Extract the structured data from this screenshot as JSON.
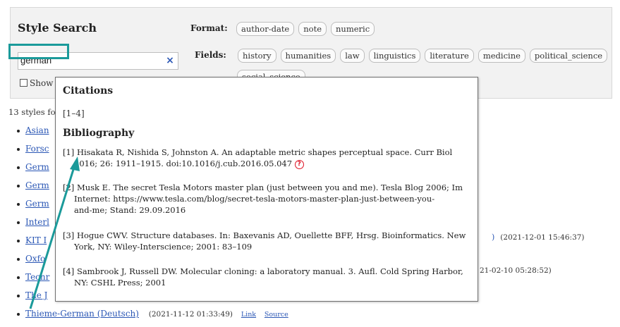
{
  "app": {
    "title": "Style Search"
  },
  "search": {
    "value": "german",
    "clear_label": "×"
  },
  "show_row": {
    "label": "Show"
  },
  "format": {
    "label": "Format:",
    "options": [
      "author-date",
      "note",
      "numeric"
    ]
  },
  "fields": {
    "label": "Fields:",
    "options": [
      "history",
      "humanities",
      "law",
      "linguistics",
      "literature",
      "medicine",
      "political_science",
      "social_science"
    ]
  },
  "results": {
    "count_text": "13 styles fo",
    "items": [
      {
        "label": "Asian"
      },
      {
        "label": "Forsc"
      },
      {
        "label": "Germ"
      },
      {
        "label": "Germ"
      },
      {
        "label": "Germ"
      },
      {
        "label": "Interl"
      },
      {
        "label": "KIT I"
      },
      {
        "label": "Oxfo"
      },
      {
        "label": "Techr"
      },
      {
        "label": "The J"
      },
      {
        "label": "Thieme-German (Deutsch)",
        "date": "(2021-11-12 01:33:49)",
        "link": "Link",
        "source": "Source"
      }
    ],
    "side_dates": [
      "(2021-12-01 15:46:37)",
      "21-02-10 05:28:52)"
    ]
  },
  "popup": {
    "citations_title": "Citations",
    "citations_value": "[1–4]",
    "bibliography_title": "Bibliography",
    "entries": [
      {
        "line1": "[1] Hisakata R, Nishida S, Johnston A. An adaptable metric shapes perceptual space. Curr Biol",
        "line2": "2016; 26: 1911–1915. doi:10.1016/j.cub.2016.05.047",
        "warn": "?"
      },
      {
        "line1": "[2] Musk E. The secret Tesla Motors master plan (just between you and me). Tesla Blog 2006; Im",
        "line2": "Internet: https://www.tesla.com/blog/secret-tesla-motors-master-plan-just-between-you-",
        "line3": "and-me; Stand: 29.09.2016"
      },
      {
        "line1": "[3] Hogue CWV. Structure databases. In: Baxevanis AD, Ouellette BFF, Hrsg. Bioinformatics. New",
        "line2": "York, NY: Wiley-Interscience; 2001: 83–109"
      },
      {
        "line1": "[4] Sambrook J, Russell DW. Molecular cloning: a laboratory manual. 3. Aufl. Cold Spring Harbor,",
        "line2": "NY: CSHL Press; 2001"
      }
    ]
  },
  "colors": {
    "accent": "#1b9a9a",
    "link": "#2b57b5"
  }
}
